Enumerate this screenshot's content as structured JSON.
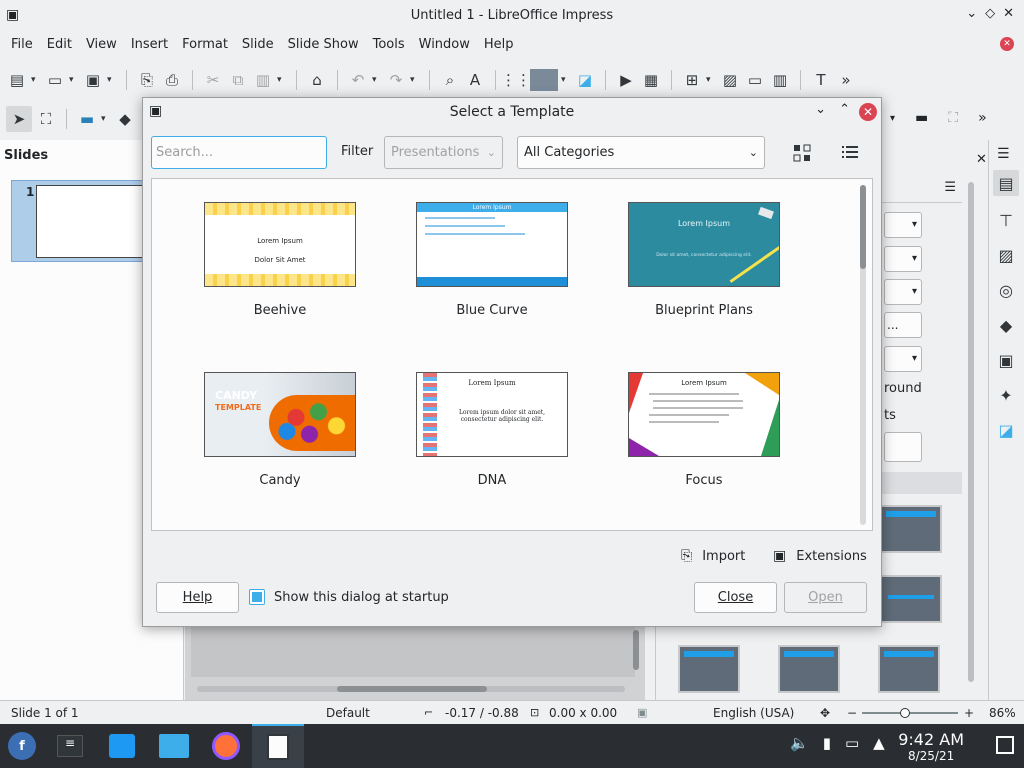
{
  "window": {
    "title": "Untitled 1 - LibreOffice Impress"
  },
  "menu": [
    "File",
    "Edit",
    "View",
    "Insert",
    "Format",
    "Slide",
    "Slide Show",
    "Tools",
    "Window",
    "Help"
  ],
  "slides_pane": {
    "title": "Slides",
    "slide_number": "1"
  },
  "right_panel": {
    "text1": "round",
    "text2": "ts"
  },
  "dialog": {
    "title": "Select a Template",
    "search_placeholder": "Search...",
    "filter_label": "Filter",
    "filter_value": "Presentations",
    "category_value": "All Categories",
    "templates": [
      {
        "name": "Beehive",
        "line1": "Lorem Ipsum",
        "line2": "Dolor Sit Amet"
      },
      {
        "name": "Blue Curve",
        "line1": "Lorem Ipsum"
      },
      {
        "name": "Blueprint Plans",
        "line1": "Lorem Ipsum",
        "line2": "Dolor sit amet, consectetur adipiscing elit."
      },
      {
        "name": "Candy",
        "line1": "CANDY",
        "line2": "TEMPLATE"
      },
      {
        "name": "DNA",
        "line1": "Lorem Ipsum",
        "line2": "Lorem ipsum dolor sit amet, consectetur adipiscing elit."
      },
      {
        "name": "Focus",
        "line1": "Lorem Ipsum"
      }
    ],
    "import_label": "Import",
    "extensions_label": "Extensions",
    "help_label": "Help",
    "startup_label": "Show this dialog at startup",
    "startup_checked": true,
    "close_label": "Close",
    "open_label": "Open"
  },
  "status": {
    "slide": "Slide 1 of 1",
    "layout": "Default",
    "position": "-0.17 / -0.88",
    "size": "0.00 x 0.00",
    "language": "English (USA)",
    "zoom": "86%"
  },
  "clock": {
    "time": "9:42 AM",
    "date": "8/25/21"
  },
  "colors": {
    "accent": "#3daee9",
    "close": "#da4453",
    "taskbar": "#2a2e32"
  }
}
